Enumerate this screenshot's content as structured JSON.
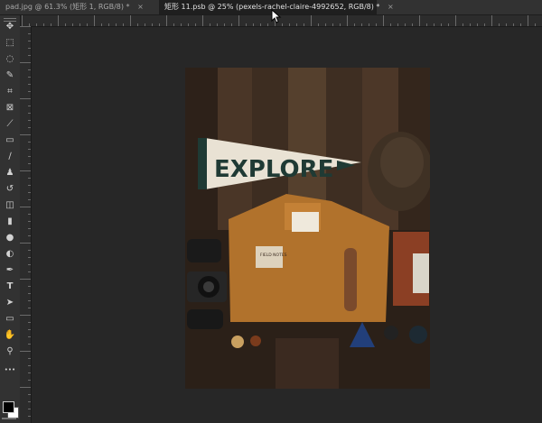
{
  "tabs": [
    {
      "title": "pad.jpg @ 61.3% (矩形 1, RGB/8) *",
      "close": "×"
    },
    {
      "title": "矩形 11.psb @ 25% (pexels-rachel-claire-4992652, RGB/8) *",
      "close": "×"
    }
  ],
  "tools": [
    {
      "name": "move-tool",
      "glyph": "✥"
    },
    {
      "name": "marquee-tool",
      "glyph": "⬚"
    },
    {
      "name": "lasso-tool",
      "glyph": "◌"
    },
    {
      "name": "quick-select-tool",
      "glyph": "✎"
    },
    {
      "name": "crop-tool",
      "glyph": "⌗"
    },
    {
      "name": "frame-tool",
      "glyph": "⊠"
    },
    {
      "name": "eyedropper-tool",
      "glyph": "⟋"
    },
    {
      "name": "healing-brush-tool",
      "glyph": "▭"
    },
    {
      "name": "brush-tool",
      "glyph": "∕"
    },
    {
      "name": "clone-stamp-tool",
      "glyph": "♟"
    },
    {
      "name": "history-brush-tool",
      "glyph": "↺"
    },
    {
      "name": "eraser-tool",
      "glyph": "◫"
    },
    {
      "name": "gradient-tool",
      "glyph": "▮"
    },
    {
      "name": "blur-tool",
      "glyph": "●"
    },
    {
      "name": "dodge-tool",
      "glyph": "◐"
    },
    {
      "name": "pen-tool",
      "glyph": "✒"
    },
    {
      "name": "type-tool",
      "glyph": "T"
    },
    {
      "name": "path-select-tool",
      "glyph": "➤"
    },
    {
      "name": "rectangle-tool",
      "glyph": "▭"
    },
    {
      "name": "hand-tool",
      "glyph": "✋"
    },
    {
      "name": "zoom-tool",
      "glyph": "⚲"
    },
    {
      "name": "more-tools",
      "glyph": "•••"
    }
  ],
  "document": {
    "pennant_text": "EXPLORE",
    "notebook_text": "FIELD NOTES"
  },
  "colors": {
    "foreground": "#000000",
    "background": "#ffffff"
  }
}
